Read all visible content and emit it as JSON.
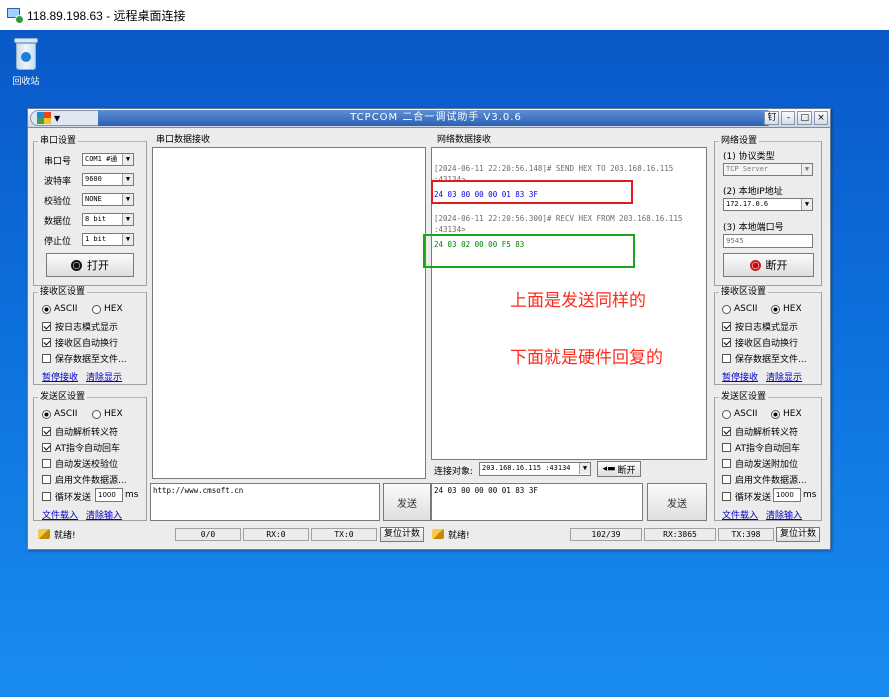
{
  "rdp": {
    "title": "118.89.198.63 - 远程桌面连接"
  },
  "desktop": {
    "recycle_label": "回收站"
  },
  "app": {
    "title": "TCPCOM 二合一调试助手  V3.0.6",
    "skin_label": "▼",
    "tb_buttons": {
      "pin": "钉",
      "min": "-",
      "max": "□",
      "close": "×"
    }
  },
  "serial": {
    "group_label": "串口设置",
    "port_label": "串口号",
    "port_value": "COM1 #通",
    "baud_label": "波特率",
    "baud_value": "9600",
    "parity_label": "校验位",
    "parity_value": "NONE",
    "data_label": "数据位",
    "data_value": "8 bit",
    "stop_label": "停止位",
    "stop_value": "1 bit",
    "open_label": "打开"
  },
  "serial_rx": {
    "group_label": "接收区设置",
    "ascii": "ASCII",
    "hex": "HEX",
    "log_mode": "按日志模式显示",
    "auto_wrap": "接收区自动换行",
    "save_file": "保存数据至文件...",
    "pause_link": "暂停接收",
    "clear_link": "清除显示"
  },
  "serial_tx": {
    "group_label": "发送区设置",
    "ascii": "ASCII",
    "hex": "HEX",
    "auto_escape": "自动解析转义符",
    "at_cr": "AT指令自动回车",
    "auto_checksum": "自动发送校验位",
    "file_source": "启用文件数据源...",
    "loop_label": "循环发送",
    "loop_ms": "1000",
    "ms": "ms",
    "load_link": "文件载入",
    "clear_link": "清除输入"
  },
  "serial_recv_area": {
    "label": "串口数据接收"
  },
  "serial_send": {
    "text": "http://www.cmsoft.cn",
    "send_label": "发送"
  },
  "net_recv": {
    "label": "网络数据接收",
    "log1_header": "[2024-06-11 22:20:56.148]# SEND HEX TO 203.168.16.115",
    "log1_port": ":43134>",
    "log1_data": "24 03 00 00 00 01 83 3F",
    "log2_header": "[2024-06-11 22:20:56.300]# RECV HEX FROM 203.168.16.115",
    "log2_port": ":43134>",
    "log2_data": "24 03 02 00 00 F5 83",
    "annotation1": "上面是发送同样的",
    "annotation2": "下面就是硬件回复的",
    "target_label": "连接对象:",
    "target_value": "203.168.16.115 :43134",
    "disconnect_label": "断开"
  },
  "net_send": {
    "text": "24 03 00 00 00 01 83 3F",
    "send_label": "发送"
  },
  "net": {
    "group_label": "网络设置",
    "proto_label": "(1) 协议类型",
    "proto_value": "TCP Server",
    "ip_label": "(2) 本地IP地址",
    "ip_value": "172.17.0.6",
    "port_label": "(3) 本地端口号",
    "port_value": "9545",
    "close_label": "断开"
  },
  "net_rx": {
    "group_label": "接收区设置",
    "ascii": "ASCII",
    "hex": "HEX",
    "log_mode": "按日志模式显示",
    "auto_wrap": "接收区自动换行",
    "save_file": "保存数据至文件...",
    "pause_link": "暂停接收",
    "clear_link": "清除显示"
  },
  "net_tx": {
    "group_label": "发送区设置",
    "ascii": "ASCII",
    "hex": "HEX",
    "auto_escape": "自动解析转义符",
    "at_cr": "AT指令自动回车",
    "auto_append": "自动发送附加位",
    "file_source": "启用文件数据源...",
    "loop_label": "循环发送",
    "loop_ms": "1000",
    "ms": "ms",
    "load_link": "文件载入",
    "clear_link": "清除输入"
  },
  "status_left": {
    "ready": "就绪!",
    "counter": "0/0",
    "rx": "RX:0",
    "tx": "TX:0",
    "reset": "复位计数"
  },
  "status_right": {
    "ready": "就绪!",
    "counter": "102/39",
    "rx": "RX:3865",
    "tx": "TX:398",
    "reset": "复位计数"
  },
  "colors": {
    "send_box": "#e11b1b",
    "recv_box": "#1aa51a",
    "send_text": "#0000ee",
    "recv_text": "#008000",
    "annotation": "#ff2a1a"
  }
}
